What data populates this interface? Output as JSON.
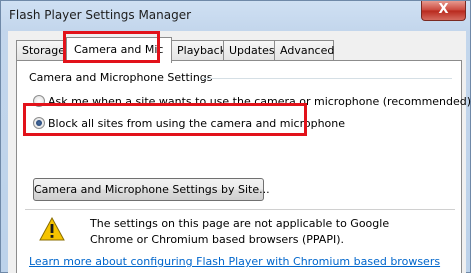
{
  "window": {
    "title": "Flash Player Settings Manager",
    "close_label": "X"
  },
  "tabs": [
    {
      "label": "Storage"
    },
    {
      "label": "Camera and Mic",
      "selected": true
    },
    {
      "label": "Playback"
    },
    {
      "label": "Updates"
    },
    {
      "label": "Advanced"
    }
  ],
  "panel": {
    "group_title": "Camera and Microphone Settings",
    "options": [
      {
        "label": "Ask me when a site wants to use the camera or microphone (recommended)",
        "checked": false
      },
      {
        "label": "Block all sites from using the camera and microphone",
        "checked": true
      }
    ],
    "site_settings_button": "Camera and Microphone Settings by Site...",
    "warning_text": "The settings on this page are not applicable to Google Chrome or Chromium based browsers (PPAPI).",
    "learn_more_link": "Learn more about configuring Flash Player with Chromium based browsers"
  },
  "colors": {
    "highlight": "#e2121a",
    "link": "#0066cc",
    "warning_icon": "#f5c400"
  },
  "icons": {
    "close": "close-icon",
    "warning": "warning-icon"
  }
}
